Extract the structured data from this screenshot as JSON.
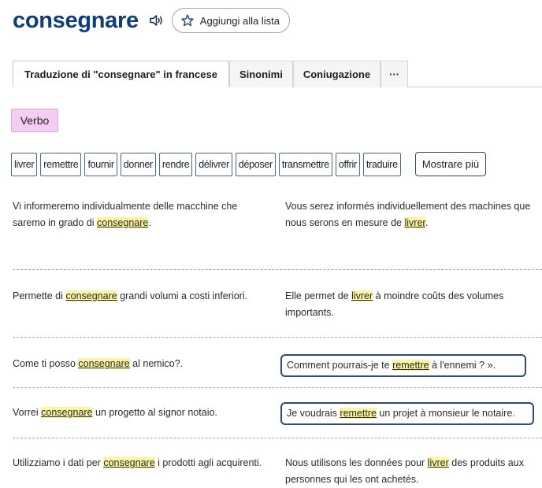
{
  "header": {
    "word": "consegnare",
    "speaker_icon": "speaker-icon",
    "add_to_list_label": "Aggiungi alla lista",
    "star_icon": "star-outline-icon"
  },
  "tabs": [
    {
      "label": "Traduzione di \"consegnare\" in francese",
      "active": true
    },
    {
      "label": "Sinonimi",
      "active": false
    },
    {
      "label": "Coniugazione",
      "active": false
    },
    {
      "label": "···",
      "active": false
    }
  ],
  "part_of_speech": "Verbo",
  "translations": [
    "livrer",
    "remettre",
    "fournir",
    "donner",
    "rendre",
    "délivrer",
    "déposer",
    "transmettre",
    "offrir",
    "traduire"
  ],
  "show_more_label": "Mostrare più",
  "examples": [
    {
      "src": [
        "Vi informeremo individualmente delle macchine che saremo in grado di ",
        "consegnare",
        "."
      ],
      "tgt": [
        "Vous serez informés individuellement des machines que nous serons en mesure de ",
        "livrer",
        "."
      ],
      "boxed": false
    },
    {
      "src": [
        "Permette di ",
        "consegnare",
        " grandi volumi a costi inferiori."
      ],
      "tgt": [
        "Elle permet de ",
        "livrer",
        " à moindre coûts des volumes importants."
      ],
      "boxed": false
    },
    {
      "src": [
        "Come ti posso ",
        "consegnare",
        " al nemico?."
      ],
      "tgt": [
        "Comment pourrais-je te ",
        "remettre",
        " à l'ennemi ? »."
      ],
      "boxed": true
    },
    {
      "src": [
        "Vorrei ",
        "consegnare",
        " un progetto al signor notaio."
      ],
      "tgt": [
        "Je voudrais ",
        "remettre",
        " un projet à monsieur le notaire."
      ],
      "boxed": true
    },
    {
      "src": [
        "Utilizziamo i dati per ",
        "consegnare",
        " i prodotti agli acquirenti."
      ],
      "tgt": [
        "Nous utilisons les données pour ",
        "livrer",
        " des produits aux personnes qui les ont achetés."
      ],
      "boxed": false
    }
  ],
  "colors": {
    "title": "#0f3d7a",
    "highlight": "#fbf4a0",
    "badge": "#f4cdf2",
    "chip_border": "#4a6a88",
    "box_border": "#2e4a70"
  }
}
